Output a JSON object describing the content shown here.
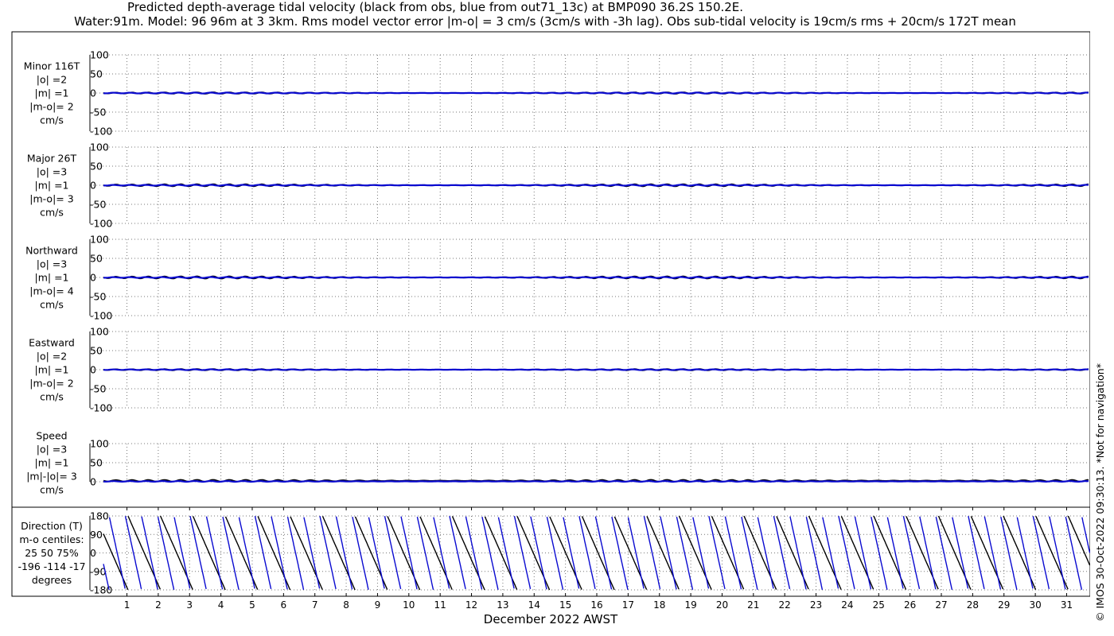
{
  "title_line1": "Predicted depth-average tidal velocity (black from obs, blue from out71_13c) at BMP090 36.2S 150.2E.",
  "title_line2": "Water:91m. Model: 96 96m at 3 3km. Rms model vector error |m-o| = 3 cm/s (3cm/s with -3h lag). Obs sub-tidal velocity is 19cm/s rms + 20cm/s 172T mean",
  "credit": "© IMOS 30-Oct-2022 09:30:13. *Not for navigation*",
  "colors": {
    "obs": "#000000",
    "model": "#0a0ad0",
    "grid": "#777777"
  },
  "chart_data": {
    "type": "line",
    "xlabel": "December 2022 AWST",
    "x_ticks": [
      1,
      2,
      3,
      4,
      5,
      6,
      7,
      8,
      9,
      10,
      11,
      12,
      13,
      14,
      15,
      16,
      17,
      18,
      19,
      20,
      21,
      22,
      23,
      24,
      25,
      26,
      27,
      28,
      29,
      30,
      31
    ],
    "xlim": [
      0.25,
      31.75
    ],
    "grid": true,
    "panels": [
      {
        "id": "minor",
        "label_lines": [
          "Minor 116T",
          "|o| =2",
          "|m| =1",
          "|m-o|= 2",
          "cm/s"
        ],
        "ylim": [
          -100,
          100
        ],
        "yticks": [
          "100",
          "50",
          "0",
          "-50",
          "-100"
        ],
        "series": [
          {
            "role": "obs",
            "amplitude": 2.2,
            "mean": 0
          },
          {
            "role": "model",
            "amplitude": 1.2,
            "mean": 0
          }
        ]
      },
      {
        "id": "major",
        "label_lines": [
          "Major 26T",
          "|o| =3",
          "|m| =1",
          "|m-o|= 3",
          "cm/s"
        ],
        "ylim": [
          -100,
          100
        ],
        "yticks": [
          "100",
          "50",
          "0",
          "-50",
          "-100"
        ],
        "series": [
          {
            "role": "obs",
            "amplitude": 3.2,
            "mean": 0
          },
          {
            "role": "model",
            "amplitude": 1.2,
            "mean": 0
          }
        ]
      },
      {
        "id": "northward",
        "label_lines": [
          "Northward",
          "|o| =3",
          "|m| =1",
          "|m-o|= 4",
          "cm/s"
        ],
        "ylim": [
          -100,
          100
        ],
        "yticks": [
          "100",
          "50",
          "0",
          "-50",
          "-100"
        ],
        "series": [
          {
            "role": "obs",
            "amplitude": 3.4,
            "mean": 0
          },
          {
            "role": "model",
            "amplitude": 1.2,
            "mean": 0
          }
        ]
      },
      {
        "id": "eastward",
        "label_lines": [
          "Eastward",
          "|o| =2",
          "|m| =1",
          "|m-o|= 2",
          "cm/s"
        ],
        "ylim": [
          -100,
          100
        ],
        "yticks": [
          "100",
          "50",
          "0",
          "-50",
          "-100"
        ],
        "series": [
          {
            "role": "obs",
            "amplitude": 2.0,
            "mean": 0
          },
          {
            "role": "model",
            "amplitude": 1.0,
            "mean": 0
          }
        ]
      },
      {
        "id": "speed",
        "label_lines": [
          "Speed",
          "|o| =3",
          "|m| =1",
          "|m|-|o|= 3",
          "cm/s"
        ],
        "ylim": [
          0,
          100
        ],
        "yticks": [
          "100",
          "50",
          "0"
        ],
        "series": [
          {
            "role": "obs",
            "amplitude": 2.5,
            "mean": 3
          },
          {
            "role": "model",
            "amplitude": 1.0,
            "mean": 1
          }
        ]
      },
      {
        "id": "direction",
        "label_lines": [
          "Direction (T)",
          "m-o centiles:",
          "25  50  75%",
          "-196 -114  -17",
          "degrees"
        ],
        "ylim": [
          -180,
          180
        ],
        "yticks": [
          "180",
          "90",
          "0",
          "-90",
          "-180"
        ],
        "series": [
          {
            "role": "obs",
            "kind": "direction_sawtooth",
            "period_days": 1.035,
            "phase_deg": 0
          },
          {
            "role": "model",
            "kind": "direction_sawtooth",
            "period_days": 0.5175,
            "phase_deg": 60
          }
        ]
      }
    ]
  }
}
